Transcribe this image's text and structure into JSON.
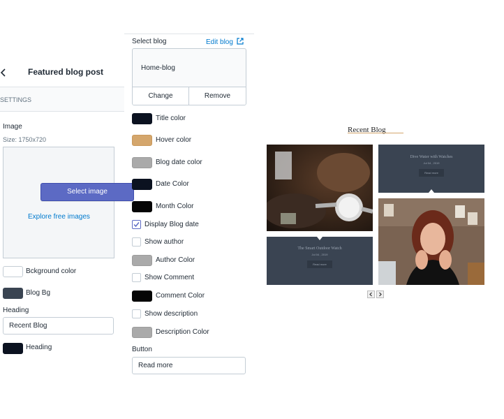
{
  "header": {
    "back_icon": "chevron-left-icon",
    "title": "Featured blog post"
  },
  "settings_label": "SETTINGS",
  "image": {
    "label": "Image",
    "size": "Size: 1750x720",
    "select_button": "Select image",
    "explore_link": "Explore free images"
  },
  "left_colors": [
    {
      "label": "Bckground color",
      "color": "#ffffff"
    },
    {
      "label": "Blog Bg",
      "color": "#3a4452"
    }
  ],
  "heading": {
    "label": "Heading",
    "value": "Recent Blog"
  },
  "heading_color": {
    "label": "Heading",
    "color": "#0b1220"
  },
  "select_blog": {
    "label": "Select blog",
    "edit_link": "Edit blog",
    "edit_icon": "external-link-icon",
    "blog_name": "Home-blog",
    "change": "Change",
    "remove": "Remove"
  },
  "options": [
    {
      "type": "color",
      "label": "Title color",
      "color": "#0b1220"
    },
    {
      "type": "color",
      "label": "Hover color",
      "color": "#d4a66c"
    },
    {
      "type": "color",
      "label": "Blog date color",
      "color": "#aaaaaa"
    },
    {
      "type": "color",
      "label": "Date Color",
      "color": "#0b1220"
    },
    {
      "type": "color",
      "label": "Month Color",
      "color": "#050505"
    },
    {
      "type": "check",
      "label": "Display Blog date",
      "checked": true
    },
    {
      "type": "check",
      "label": "Show author",
      "checked": false
    },
    {
      "type": "color",
      "label": "Author Color",
      "color": "#aaaaaa"
    },
    {
      "type": "check",
      "label": "Show Comment",
      "checked": false
    },
    {
      "type": "color",
      "label": "Comment Color",
      "color": "#050505"
    },
    {
      "type": "check",
      "label": "Show description",
      "checked": false
    },
    {
      "type": "color",
      "label": "Description Color",
      "color": "#aaaaaa"
    }
  ],
  "button_setting": {
    "label": "Button",
    "value": "Read more"
  },
  "preview": {
    "title": "Recent Blog",
    "posts": [
      {
        "title": "Dive Water with Watches",
        "date": "Jul 04 , 2019",
        "button": "Read more"
      },
      {
        "title": "The Smart Outdoor Watch",
        "date": "Jul 04 , 2019",
        "button": "Read more"
      }
    ],
    "prev_icon": "chevron-left-icon",
    "next_icon": "chevron-right-icon"
  }
}
